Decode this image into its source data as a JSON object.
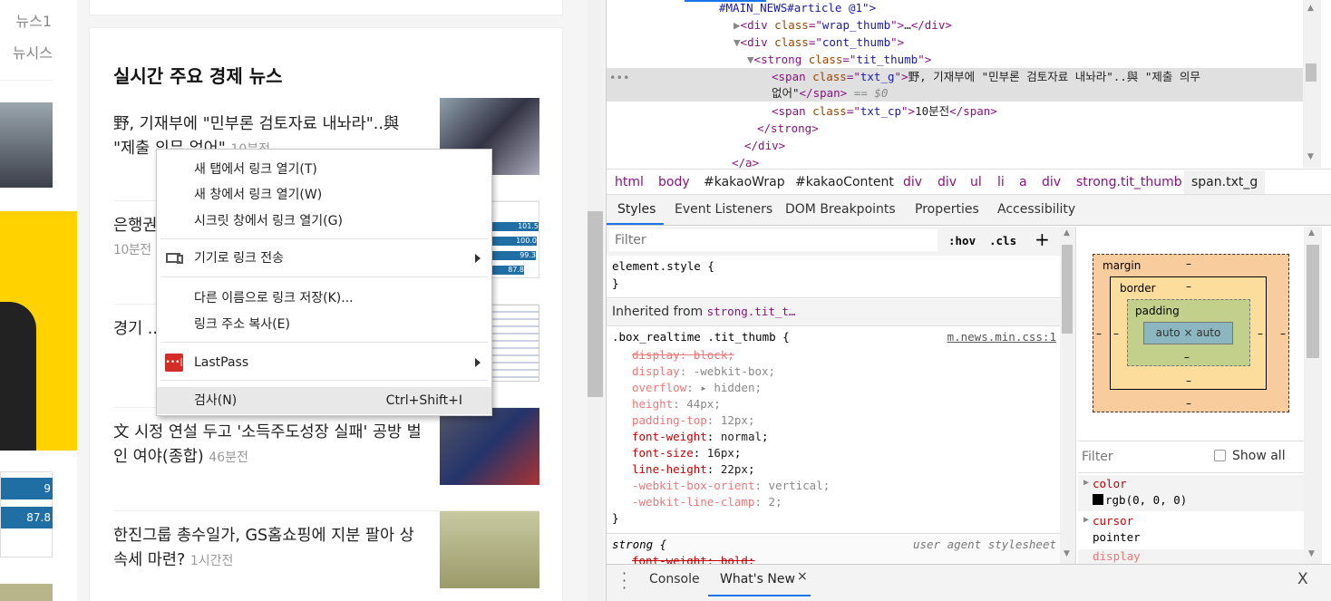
{
  "left_column": {
    "sources": [
      "뉴스1",
      "뉴시스"
    ],
    "chart_values": [
      "9",
      "87.8"
    ]
  },
  "news_card": {
    "title": "실시간 주요 경제 뉴스",
    "items": [
      {
        "title": "野, 기재부에 \"민부론 검토자료 내놔라\"..與 \"제출 의무 없어\"",
        "time": "10분전"
      },
      {
        "title": "은행권 ... 상",
        "time": "10분전"
      },
      {
        "title": "경기 ... 주요국",
        "time": ""
      },
      {
        "title": "文 시정 연설 두고 '소득주도성장 실패' 공방 벌인 여야(종합)",
        "time": "46분전"
      },
      {
        "title": "한진그룹 총수일가, GS홈쇼핑에 지분 팔아 상속세 마련?",
        "time": "1시간전"
      }
    ],
    "thumb_chart_values": [
      "101.5",
      "100.0",
      "99.3",
      "87.8"
    ]
  },
  "context_menu": {
    "items": [
      {
        "label": "새 탭에서 링크 열기(T)"
      },
      {
        "label": "새 창에서 링크 열기(W)"
      },
      {
        "label": "시크릿 창에서 링크 열기(G)"
      },
      {
        "label": "기기로 링크 전송",
        "icon": "devices-icon",
        "submenu": true
      },
      {
        "label": "다른 이름으로 링크 저장(K)..."
      },
      {
        "label": "링크 주소 복사(E)"
      },
      {
        "label": "LastPass",
        "icon": "lastpass-icon",
        "submenu": true
      },
      {
        "label": "검사(N)",
        "shortcut": "Ctrl+Shift+I",
        "highlighted": true
      }
    ]
  },
  "devtools": {
    "elements": {
      "line0": "#MAIN_NEWS#article @1\">",
      "wrap_thumb": {
        "tag": "div",
        "attr": "class",
        "val": "wrap_thumb"
      },
      "cont_thumb": {
        "tag": "div",
        "attr": "class",
        "val": "cont_thumb"
      },
      "tit_thumb": {
        "tag": "strong",
        "attr": "class",
        "val": "tit_thumb"
      },
      "txt_g": {
        "tag": "span",
        "attr": "class",
        "val": "txt_g",
        "text1": "野, 기재부에 \"민부론 검토자료 내놔라\"..與 \"제출 의무",
        "text2": "없어\"",
        "marker": "== $0"
      },
      "txt_cp": {
        "tag": "span",
        "attr": "class",
        "val": "txt_cp",
        "text": "10분전"
      },
      "close_strong": "</strong>",
      "close_div": "</div>",
      "close_a": "</a>",
      "ellipsis": "…"
    },
    "breadcrumb": [
      "html",
      "body",
      "#kakaoWrap",
      "#kakaoContent",
      "div",
      "div",
      "ul",
      "li",
      "a",
      "div",
      "strong.tit_thumb",
      "span.txt_g"
    ],
    "tabs": [
      "Styles",
      "Event Listeners",
      "DOM Breakpoints",
      "Properties",
      "Accessibility"
    ],
    "active_tab": "Styles",
    "styles": {
      "filter_placeholder": "Filter",
      "hov": ":hov",
      "cls": ".cls",
      "plus": "+",
      "element_style": "element.style {",
      "close": "}",
      "inherited_label": "Inherited from",
      "inherited_from": "strong.tit_t…",
      "rule_selector": ".box_realtime .tit_thumb {",
      "rule_source": "m.news.min.css:1",
      "props": [
        {
          "name": "display",
          "value": "block",
          "state": "overridden"
        },
        {
          "name": "display",
          "value": "-webkit-box",
          "state": "inactive"
        },
        {
          "name": "overflow",
          "value": "hidden",
          "state": "inactive",
          "expandable": true
        },
        {
          "name": "height",
          "value": "44px",
          "state": "inactive"
        },
        {
          "name": "padding-top",
          "value": "12px",
          "state": "inactive"
        },
        {
          "name": "font-weight",
          "value": "normal",
          "state": "active"
        },
        {
          "name": "font-size",
          "value": "16px",
          "state": "active"
        },
        {
          "name": "line-height",
          "value": "22px",
          "state": "active"
        },
        {
          "name": "-webkit-box-orient",
          "value": "vertical",
          "state": "inactive"
        },
        {
          "name": "-webkit-line-clamp",
          "value": "2",
          "state": "inactive"
        }
      ],
      "ua_selector": "strong {",
      "ua_source": "user agent stylesheet",
      "ua_prop": "font-weight: bold;"
    },
    "box_model": {
      "margin": "margin",
      "border": "border",
      "padding": "padding",
      "content": "auto × auto",
      "dash": "–"
    },
    "computed": {
      "filter_placeholder": "Filter",
      "show_all": "Show all",
      "show_all_checked": false,
      "props": [
        {
          "name": "color",
          "value": "rgb(0, 0, 0)",
          "swatch": "#000000"
        },
        {
          "name": "cursor",
          "value": "pointer"
        },
        {
          "name": "display",
          "value": ""
        }
      ]
    },
    "drawer": {
      "tabs": [
        "Console",
        "What's New"
      ],
      "active": "What's New",
      "close": "×",
      "close_drawer": "X"
    }
  },
  "colors": {
    "accent": "#1a73e8",
    "lastpass": "#d32d27",
    "yellow": "#ffd200",
    "chart_blue": "#1f6ea4"
  }
}
